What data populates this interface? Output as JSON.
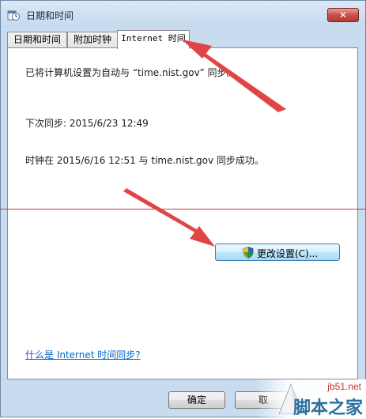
{
  "window": {
    "title": "日期和时间",
    "close_glyph": "✕"
  },
  "tabs": [
    {
      "label": "日期和时间"
    },
    {
      "label": "附加时钟"
    },
    {
      "label": "Internet 时间"
    }
  ],
  "panel": {
    "sync_configured": "已将计算机设置为自动与 “time.nist.gov” 同步。",
    "next_sync": "下次同步: 2015/6/23 12:49",
    "last_sync": "时钟在 2015/6/16 12:51 与 time.nist.gov 同步成功。",
    "change_settings_label": "更改设置(C)...",
    "help_link": "什么是 Internet 时间同步?"
  },
  "buttons": {
    "ok_label": "确定",
    "cancel_label": "取"
  },
  "watermark": {
    "site": "jb51.net",
    "name": "脚本之家"
  },
  "colors": {
    "annotation_arrow": "#e04040",
    "link": "#0066cc"
  }
}
